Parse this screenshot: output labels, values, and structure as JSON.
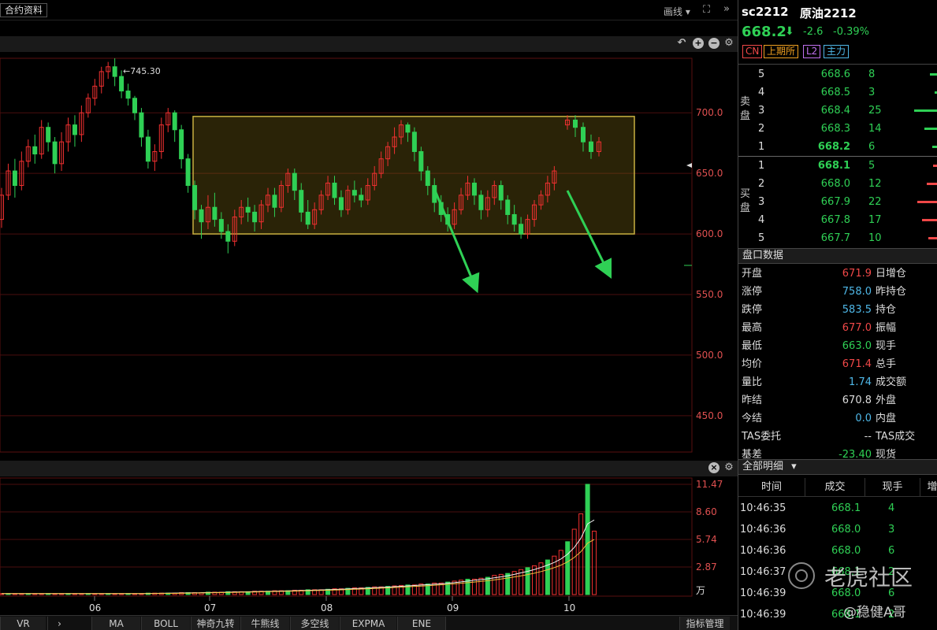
{
  "toolbar": {
    "contract_info": "合约资料",
    "draw_line": "画线",
    "dropdown_glyph": "▾",
    "fullscreen_glyph": "⛶",
    "expand_glyph": "»"
  },
  "chart_controls": {
    "undo": "↶",
    "plus": "+",
    "minus": "−",
    "gear": "⚙",
    "close": "×"
  },
  "chart_data": [
    {
      "type": "candlestick",
      "title": "",
      "x_ticks": [
        "06",
        "07",
        "08",
        "09",
        "10"
      ],
      "y_ticks": [
        "700.0",
        "650.0",
        "600.0",
        "550.0",
        "500.0",
        "450.0"
      ],
      "ylim": [
        420,
        745
      ],
      "annotations": {
        "high_label": "←745.30",
        "range_box": {
          "low": 600,
          "high": 697
        },
        "arrows": [
          {
            "from": [
              53,
              690
            ],
            "to": [
              63,
              610
            ]
          },
          {
            "from": [
              83,
              690
            ],
            "to": [
              94,
              618
            ]
          }
        ]
      },
      "candles": [
        [
          612,
          632,
          605,
          638
        ],
        [
          632,
          652,
          628,
          658
        ],
        [
          652,
          640,
          630,
          662
        ],
        [
          640,
          660,
          636,
          668
        ],
        [
          660,
          672,
          655,
          678
        ],
        [
          672,
          666,
          658,
          682
        ],
        [
          666,
          688,
          662,
          694
        ],
        [
          688,
          676,
          668,
          692
        ],
        [
          676,
          658,
          650,
          680
        ],
        [
          658,
          676,
          652,
          684
        ],
        [
          676,
          690,
          668,
          696
        ],
        [
          690,
          682,
          672,
          698
        ],
        [
          682,
          700,
          676,
          706
        ],
        [
          700,
          712,
          696,
          716
        ],
        [
          712,
          722,
          706,
          728
        ],
        [
          722,
          734,
          716,
          738
        ],
        [
          734,
          738,
          728,
          742
        ],
        [
          738,
          730,
          722,
          745
        ],
        [
          730,
          718,
          712,
          735
        ],
        [
          718,
          712,
          706,
          724
        ],
        [
          712,
          700,
          694,
          714
        ],
        [
          700,
          680,
          672,
          704
        ],
        [
          680,
          660,
          654,
          686
        ],
        [
          660,
          668,
          652,
          674
        ],
        [
          668,
          690,
          662,
          696
        ],
        [
          690,
          700,
          684,
          704
        ],
        [
          700,
          686,
          676,
          702
        ],
        [
          686,
          662,
          654,
          690
        ],
        [
          662,
          640,
          634,
          666
        ],
        [
          640,
          620,
          612,
          644
        ],
        [
          620,
          610,
          596,
          624
        ],
        [
          610,
          622,
          604,
          632
        ],
        [
          622,
          612,
          606,
          634
        ],
        [
          612,
          602,
          596,
          618
        ],
        [
          602,
          594,
          584,
          608
        ],
        [
          594,
          614,
          590,
          620
        ],
        [
          614,
          622,
          608,
          628
        ],
        [
          622,
          618,
          610,
          630
        ],
        [
          618,
          610,
          602,
          624
        ],
        [
          610,
          624,
          604,
          628
        ],
        [
          624,
          632,
          618,
          638
        ],
        [
          632,
          622,
          614,
          638
        ],
        [
          622,
          640,
          618,
          644
        ],
        [
          640,
          650,
          634,
          654
        ],
        [
          650,
          636,
          628,
          654
        ],
        [
          636,
          618,
          610,
          642
        ],
        [
          618,
          608,
          604,
          628
        ],
        [
          608,
          620,
          604,
          626
        ],
        [
          620,
          632,
          616,
          636
        ],
        [
          632,
          642,
          628,
          648
        ],
        [
          642,
          630,
          624,
          648
        ],
        [
          630,
          620,
          614,
          636
        ],
        [
          620,
          636,
          616,
          640
        ],
        [
          636,
          632,
          626,
          644
        ],
        [
          632,
          628,
          622,
          638
        ],
        [
          628,
          640,
          624,
          646
        ],
        [
          640,
          650,
          636,
          656
        ],
        [
          650,
          662,
          646,
          668
        ],
        [
          662,
          672,
          656,
          676
        ],
        [
          672,
          680,
          666,
          688
        ],
        [
          680,
          690,
          674,
          694
        ],
        [
          690,
          684,
          676,
          692
        ],
        [
          684,
          668,
          660,
          688
        ],
        [
          668,
          652,
          644,
          672
        ],
        [
          652,
          640,
          632,
          656
        ],
        [
          640,
          626,
          618,
          646
        ],
        [
          626,
          616,
          610,
          632
        ],
        [
          616,
          608,
          602,
          622
        ],
        [
          608,
          620,
          604,
          626
        ],
        [
          620,
          632,
          616,
          638
        ],
        [
          632,
          642,
          628,
          648
        ],
        [
          642,
          632,
          624,
          646
        ],
        [
          632,
          620,
          612,
          636
        ],
        [
          620,
          630,
          614,
          636
        ],
        [
          630,
          640,
          624,
          644
        ],
        [
          640,
          628,
          620,
          644
        ],
        [
          628,
          616,
          608,
          632
        ],
        [
          616,
          608,
          602,
          624
        ],
        [
          608,
          600,
          596,
          614
        ],
        [
          600,
          612,
          596,
          616
        ],
        [
          612,
          624,
          606,
          628
        ],
        [
          624,
          632,
          620,
          636
        ],
        [
          632,
          642,
          626,
          648
        ],
        [
          642,
          652,
          636,
          656
        ],
        [
          690,
          694,
          686,
          698
        ],
        [
          694,
          688,
          680,
          698
        ],
        [
          688,
          676,
          668,
          692
        ],
        [
          676,
          668,
          662,
          682
        ],
        [
          668,
          676,
          664,
          680
        ]
      ]
    },
    {
      "type": "bar",
      "title": "",
      "y_ticks": [
        "11.47",
        "8.60",
        "5.74",
        "2.87"
      ],
      "unit": "万",
      "ylim": [
        0,
        11.47
      ],
      "values": [
        0.1,
        0.1,
        0.1,
        0.1,
        0.1,
        0.1,
        0.1,
        0.1,
        0.1,
        0.1,
        0.1,
        0.1,
        0.1,
        0.1,
        0.1,
        0.1,
        0.1,
        0.1,
        0.1,
        0.1,
        0.1,
        0.1,
        0.15,
        0.15,
        0.15,
        0.15,
        0.15,
        0.2,
        0.2,
        0.2,
        0.2,
        0.25,
        0.25,
        0.25,
        0.3,
        0.3,
        0.3,
        0.3,
        0.35,
        0.35,
        0.35,
        0.4,
        0.4,
        0.4,
        0.45,
        0.45,
        0.5,
        0.5,
        0.5,
        0.55,
        0.6,
        0.6,
        0.65,
        0.7,
        0.7,
        0.75,
        0.8,
        0.8,
        0.85,
        0.9,
        0.95,
        1.0,
        1.0,
        1.1,
        1.1,
        1.2,
        1.2,
        1.3,
        1.4,
        1.5,
        1.6,
        1.6,
        1.7,
        1.8,
        2.0,
        2.1,
        2.2,
        2.4,
        2.6,
        2.8,
        3.0,
        3.3,
        3.6,
        4.0,
        4.6,
        5.5,
        6.8,
        8.4,
        11.47,
        6.6
      ]
    }
  ],
  "bottom_tabs": [
    "VR",
    "MA",
    "BOLL",
    "神奇九转",
    "牛熊线",
    "多空线",
    "EXPMA",
    "ENE",
    "指标管理"
  ],
  "bottom_arrow": "›",
  "quote": {
    "code": "sc2212",
    "name": "原油2212",
    "last": "668.2",
    "down_glyph": "⬇",
    "change": "-2.6",
    "pct": "-0.39%",
    "tags": [
      "CN",
      "上期所",
      "L2",
      "主力"
    ]
  },
  "orderbook": {
    "sell_label": [
      "卖",
      "盘"
    ],
    "buy_label": [
      "买",
      "盘"
    ],
    "sell": [
      {
        "level": "5",
        "price": "668.6",
        "qty": "8"
      },
      {
        "level": "4",
        "price": "668.5",
        "qty": "3"
      },
      {
        "level": "3",
        "price": "668.4",
        "qty": "25"
      },
      {
        "level": "2",
        "price": "668.3",
        "qty": "14"
      },
      {
        "level": "1",
        "price": "668.2",
        "qty": "6"
      }
    ],
    "buy": [
      {
        "level": "1",
        "price": "668.1",
        "qty": "5"
      },
      {
        "level": "2",
        "price": "668.0",
        "qty": "12"
      },
      {
        "level": "3",
        "price": "667.9",
        "qty": "22"
      },
      {
        "level": "4",
        "price": "667.8",
        "qty": "17"
      },
      {
        "level": "5",
        "price": "667.7",
        "qty": "10"
      }
    ]
  },
  "market_data": {
    "title": "盘口数据",
    "rows": [
      {
        "label": "开盘",
        "value": "671.9",
        "color": "#f04848",
        "label2": "日增仓"
      },
      {
        "label": "涨停",
        "value": "758.0",
        "color": "#4fb8e8",
        "label2": "昨持仓"
      },
      {
        "label": "跌停",
        "value": "583.5",
        "color": "#4fb8e8",
        "label2": "持仓"
      },
      {
        "label": "最高",
        "value": "677.0",
        "color": "#f04848",
        "label2": "振幅"
      },
      {
        "label": "最低",
        "value": "663.0",
        "color": "#2fd055",
        "label2": "现手"
      },
      {
        "label": "均价",
        "value": "671.4",
        "color": "#f04848",
        "label2": "总手"
      },
      {
        "label": "量比",
        "value": "1.74",
        "color": "#4fb8e8",
        "label2": "成交额"
      },
      {
        "label": "昨结",
        "value": "670.8",
        "color": "#dddddd",
        "label2": "外盘"
      },
      {
        "label": "今结",
        "value": "0.0",
        "color": "#4fb8e8",
        "label2": "内盘"
      },
      {
        "label": "TAS委托",
        "value": "--",
        "color": "#dddddd",
        "label2": "TAS成交"
      },
      {
        "label": "基差",
        "value": "-23.40",
        "color": "#2fd055",
        "label2": "现货"
      }
    ]
  },
  "details": {
    "title": "全部明细",
    "dropdown_glyph": "▾",
    "headers": [
      "时间",
      "成交",
      "现手",
      "增"
    ],
    "rows": [
      {
        "time": "10:46:35",
        "price": "668.1",
        "vol": "4"
      },
      {
        "time": "10:46:36",
        "price": "668.0",
        "vol": "3"
      },
      {
        "time": "10:46:36",
        "price": "668.0",
        "vol": "6"
      },
      {
        "time": "10:46:37",
        "price": "668.1",
        "vol": "2"
      },
      {
        "time": "10:46:39",
        "price": "668.0",
        "vol": "6"
      },
      {
        "time": "10:46:39",
        "price": "668.1",
        "vol": "2"
      }
    ]
  },
  "watermark": {
    "brand": "老虎社区",
    "user": "@稳健A哥"
  }
}
